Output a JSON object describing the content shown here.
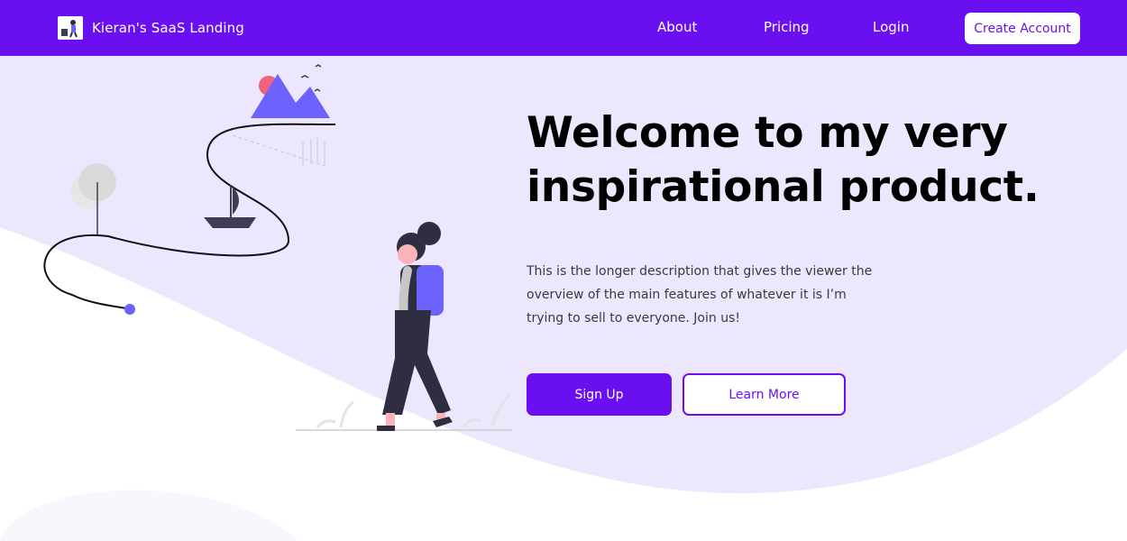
{
  "navbar": {
    "brand_name": "Kieran's SaaS Landing",
    "links": [
      "About",
      "Pricing",
      "Login"
    ],
    "cta_label": "Create Account"
  },
  "hero": {
    "headline": "Welcome to my very inspirational product.",
    "description": "This is the longer description that gives the viewer the overview of the main features of whatever it is I’m trying to sell to everyone. Join us!",
    "primary_button": "Sign Up",
    "secondary_button": "Learn More"
  },
  "colors": {
    "brand": "#6a10f0",
    "hero_background": "#ece7fd",
    "illustration_accent": "#6c63ff",
    "sun": "#f0627b"
  },
  "icons": {
    "logo": "traveler-logo-icon"
  }
}
